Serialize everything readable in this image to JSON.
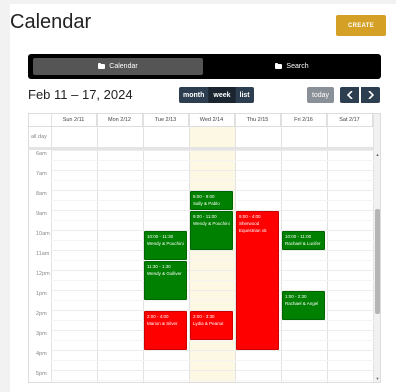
{
  "header": {
    "title": "Calendar",
    "create_label": "CREATE"
  },
  "tabs": [
    {
      "label": "Calendar",
      "icon": "folder-icon",
      "active": true
    },
    {
      "label": "Search",
      "icon": "folder-icon",
      "active": false
    }
  ],
  "toolbar": {
    "date_range": "Feb 11 – 17, 2024",
    "views": [
      {
        "label": "month",
        "active": false
      },
      {
        "label": "week",
        "active": true
      },
      {
        "label": "list",
        "active": false
      }
    ],
    "today_label": "today",
    "prev_icon": "chevron-left-icon",
    "next_icon": "chevron-right-icon"
  },
  "calendar": {
    "days": [
      "Sun 2/11",
      "Mon 2/12",
      "Tue 2/13",
      "Wed 2/14",
      "Thu 2/15",
      "Fri 2/16",
      "Sat 2/17"
    ],
    "allday_label": "all day",
    "times": [
      "6am",
      "7am",
      "8am",
      "9am",
      "10am",
      "11am",
      "12pm",
      "1pm",
      "2pm",
      "3pm",
      "4pm",
      "5pm"
    ],
    "today_index": 3,
    "events": [
      {
        "time": "8:00 - 9:00",
        "title": "Sally & Pablo",
        "day": 3,
        "color": "green"
      },
      {
        "time": "9:00 - 11:00",
        "title": "Wendy & Pouchini",
        "day": 3,
        "color": "green"
      },
      {
        "time": "9:00 - 4:00",
        "title": "Sherwood Equestrian x5",
        "day": 4,
        "color": "red"
      },
      {
        "time": "10:00 - 11:30",
        "title": "Wendy & Pouchini",
        "day": 2,
        "color": "green"
      },
      {
        "time": "10:00 - 11:00",
        "title": "Rachael & Lucifer",
        "day": 5,
        "color": "green"
      },
      {
        "time": "11:30 - 1:30",
        "title": "Wendy & Gulliver",
        "day": 2,
        "color": "green"
      },
      {
        "time": "1:00 - 2:30",
        "title": "Rachael & Angel",
        "day": 5,
        "color": "green"
      },
      {
        "time": "2:00 - 4:00",
        "title": "Marion & Silver",
        "day": 2,
        "color": "red"
      },
      {
        "time": "2:00 - 3:30",
        "title": "Lydia & Peanut",
        "day": 3,
        "color": "red"
      }
    ]
  },
  "colors": {
    "create": "#d4a025",
    "nav": "#2c3e50",
    "event_green": "#008000",
    "event_red": "#ff0000",
    "today_bg": "#fcf8e3"
  }
}
